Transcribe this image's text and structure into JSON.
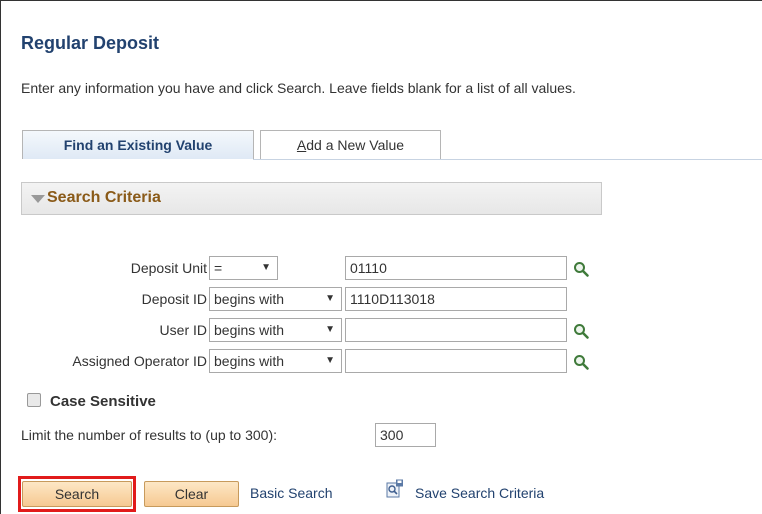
{
  "page": {
    "title": "Regular Deposit",
    "instructions": "Enter any information you have and click Search. Leave fields blank for a list of all values."
  },
  "tabs": [
    {
      "label": "Find an Existing Value",
      "active": true
    },
    {
      "label_first": "A",
      "label_rest": "dd a New Value",
      "active": false
    }
  ],
  "search_criteria": {
    "title": "Search Criteria",
    "fields": [
      {
        "label": "Deposit Unit",
        "operator": "=",
        "value": "01110",
        "has_lookup": true
      },
      {
        "label": "Deposit ID",
        "operator": "begins with",
        "value": "1110D113018",
        "has_lookup": false
      },
      {
        "label": "User ID",
        "operator": "begins with",
        "value": "",
        "has_lookup": true
      },
      {
        "label": "Assigned Operator ID",
        "operator": "begins with",
        "value": "",
        "has_lookup": true
      }
    ],
    "case_sensitive_label": "Case Sensitive",
    "case_sensitive_checked": false,
    "limit_label": "Limit the number of results to (up to 300):",
    "limit_value": "300"
  },
  "actions": {
    "search_label": "Search",
    "clear_label": "Clear",
    "basic_search_label": "Basic Search",
    "save_search_label": "Save Search Criteria"
  },
  "icons": {
    "lookup": "magnifier-icon",
    "save_criteria": "save-search-icon"
  },
  "colors": {
    "title": "#22426f",
    "group_title": "#8a5a18",
    "button_top": "#fde7c5",
    "button_bottom": "#f6c992",
    "highlight": "#e11b1b"
  }
}
